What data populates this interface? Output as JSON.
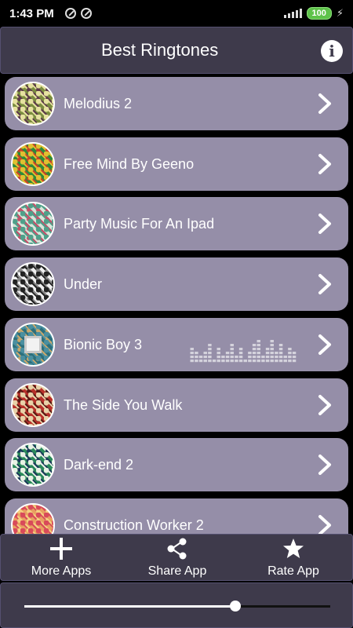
{
  "status": {
    "time": "1:43 PM",
    "battery": "100"
  },
  "header": {
    "title": "Best Ringtones"
  },
  "ringtones": [
    {
      "title": "Melodius 2",
      "art_colors": [
        "#7b8d3f",
        "#e6e2a0",
        "#5b3a4a"
      ],
      "playing": false
    },
    {
      "title": "Free Mind By Geeno",
      "art_colors": [
        "#2e8b3a",
        "#e0c030",
        "#c8402a"
      ],
      "playing": false
    },
    {
      "title": "Party Music For An Ipad",
      "art_colors": [
        "#d8e6da",
        "#4fa08a",
        "#c4506a"
      ],
      "playing": false
    },
    {
      "title": "Under",
      "art_colors": [
        "#f0f0f0",
        "#222222",
        "#888888"
      ],
      "playing": false
    },
    {
      "title": "Bionic Boy 3",
      "art_colors": [
        "#2c6f7c",
        "#4a8fa0",
        "#c9a86c"
      ],
      "playing": true
    },
    {
      "title": "The Side You Walk",
      "art_colors": [
        "#b8302a",
        "#e8d2a8",
        "#5a1a14"
      ],
      "playing": false
    },
    {
      "title": "Dark-end 2",
      "art_colors": [
        "#2a8a5a",
        "#e8f2e4",
        "#1a3a5a"
      ],
      "playing": false
    },
    {
      "title": "Construction Worker 2",
      "art_colors": [
        "#e8a060",
        "#d84a5a",
        "#f4d080"
      ],
      "playing": false
    }
  ],
  "equalizer": {
    "levels": [
      4,
      3,
      2,
      3,
      5,
      1,
      4,
      2,
      3,
      5,
      2,
      4,
      1,
      3,
      5,
      6,
      2,
      4,
      6,
      3,
      5,
      2,
      4,
      3
    ]
  },
  "actions": {
    "more_apps": "More Apps",
    "share_app": "Share App",
    "rate_app": "Rate App"
  },
  "player": {
    "progress": 0.69
  },
  "colors": {
    "bar_bg": "#3e3a4b",
    "row_bg": "#958ea8",
    "accent": "#ffffff"
  }
}
